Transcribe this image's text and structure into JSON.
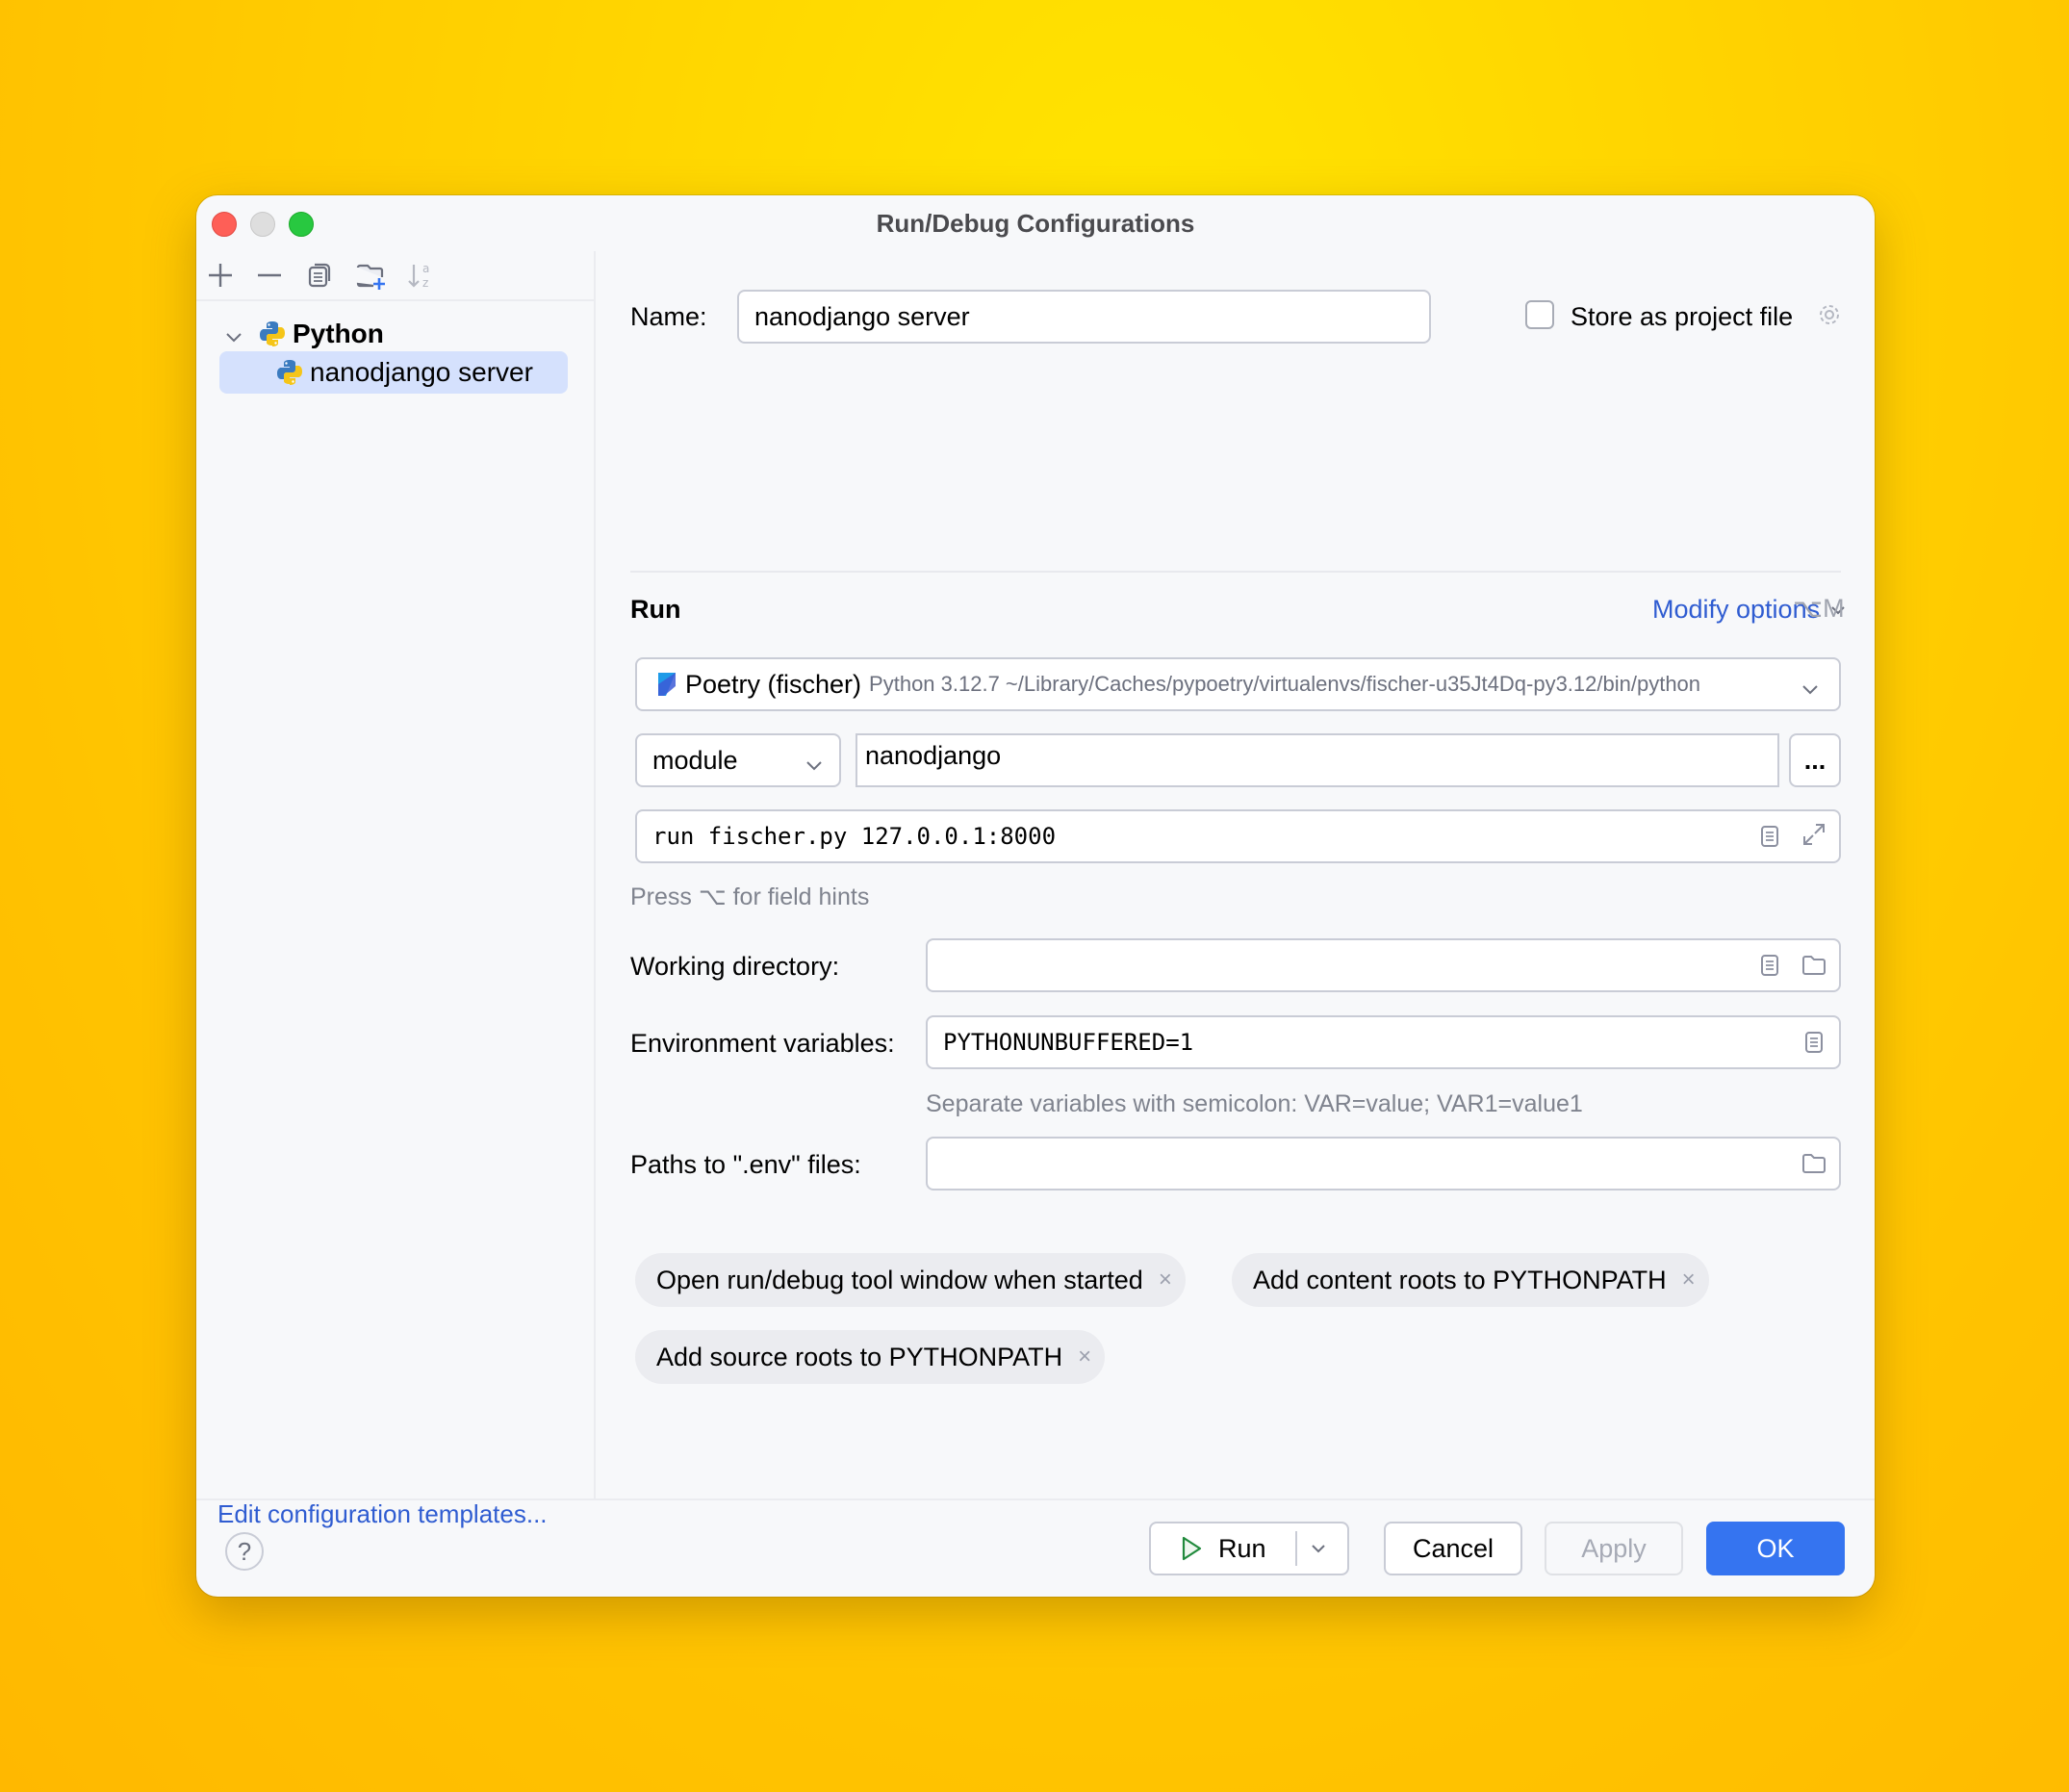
{
  "window": {
    "title": "Run/Debug Configurations"
  },
  "sidebar": {
    "toolbar": [
      {
        "icon": "plus-icon",
        "tooltip": "Add"
      },
      {
        "icon": "minus-icon",
        "tooltip": "Remove"
      },
      {
        "icon": "copy-icon",
        "tooltip": "Copy"
      },
      {
        "icon": "new-folder-icon",
        "tooltip": "New folder"
      },
      {
        "icon": "sort-alpha-icon",
        "tooltip": "Sort"
      }
    ],
    "tree": {
      "group_label": "Python",
      "items": [
        {
          "label": "nanodjango server",
          "selected": true
        }
      ]
    },
    "edit_templates_link": "Edit configuration templates..."
  },
  "main": {
    "name_label": "Name:",
    "name_value": "nanodjango server",
    "store_as_project_file": {
      "label": "Store as project file",
      "checked": false
    },
    "run_section_title": "Run",
    "modify_options": {
      "label": "Modify options",
      "shortcut": "⌥M"
    },
    "interpreter": {
      "name": "Poetry (fischer)",
      "detail": "Python 3.12.7 ~/Library/Caches/pypoetry/virtualenvs/fischer-u35Jt4Dq-py3.12/bin/python"
    },
    "target_type": "module",
    "target_value": "nanodjango",
    "browse_button": "...",
    "parameters": "run fischer.py 127.0.0.1:8000",
    "field_hint": "Press ⌥ for field hints",
    "working_directory": {
      "label": "Working directory:",
      "value": ""
    },
    "environment_variables": {
      "label": "Environment variables:",
      "value": "PYTHONUNBUFFERED=1",
      "hint": "Separate variables with semicolon: VAR=value; VAR1=value1"
    },
    "env_files": {
      "label": "Paths to \".env\" files:",
      "value": ""
    },
    "options_chips": [
      {
        "label": "Open run/debug tool window when started"
      },
      {
        "label": "Add content roots to PYTHONPATH"
      },
      {
        "label": "Add source roots to PYTHONPATH"
      }
    ],
    "chip_remove_glyph": "×"
  },
  "footer": {
    "help_glyph": "?",
    "run_label": "Run",
    "cancel_label": "Cancel",
    "apply_label": "Apply",
    "ok_label": "OK"
  },
  "colors": {
    "accent": "#3574f0",
    "link": "#2f5cd1",
    "selection": "#d5e1fd",
    "run_green": "#208a3c"
  }
}
